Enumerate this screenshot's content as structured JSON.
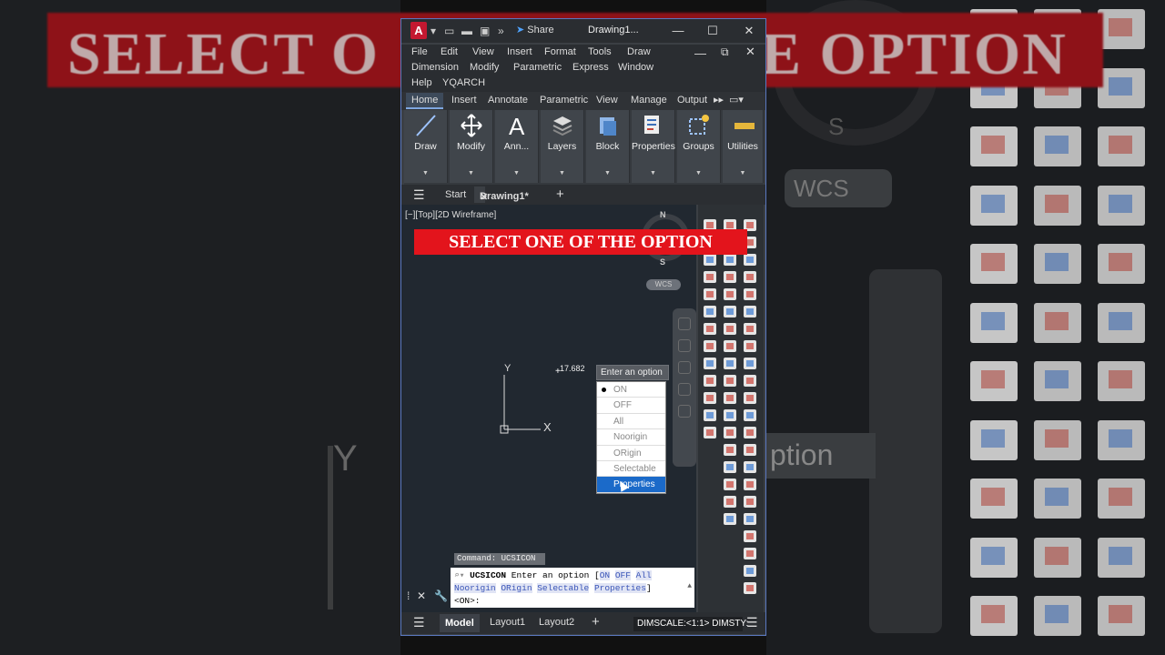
{
  "app": {
    "logo_letter": "A",
    "share_label": "Share",
    "window_title": "Drawing1..."
  },
  "menu": [
    "File",
    "Edit",
    "View",
    "Insert",
    "Format",
    "Tools",
    "Draw",
    "Dimension",
    "Modify",
    "Parametric",
    "Express",
    "Window",
    "Help",
    "YQARCH"
  ],
  "ribbon_tabs": [
    "Home",
    "Insert",
    "Annotate",
    "Parametric",
    "View",
    "Manage",
    "Output"
  ],
  "ribbon_panels": [
    "Draw",
    "Modify",
    "Ann...",
    "Layers",
    "Block",
    "Properties",
    "Groups",
    "Utilities"
  ],
  "file_tabs": {
    "start": "Start",
    "active": "Drawing1*",
    "close": "✕",
    "add": "+"
  },
  "viewport_label": "[−][Top][2D Wireframe]",
  "overlay_banner": "SELECT ONE OF THE OPTION",
  "compass": {
    "north": "N",
    "south": "S",
    "wcs": "WCS"
  },
  "ucs_icon": {
    "y_label": "Y",
    "x_label": "X"
  },
  "coordinate_readout": "17.682",
  "prompt_tooltip": "Enter an option",
  "options": [
    "ON",
    "OFF",
    "All",
    "Noorigin",
    "ORigin",
    "Selectable",
    "Properties"
  ],
  "options_current": "ON",
  "options_highlighted": "Properties",
  "command_history": "Command: UCSICON",
  "command_line": {
    "command": "UCSICON",
    "prompt_text": "Enter an option [",
    "keywords": [
      "ON",
      "OFF",
      "All",
      "Noorigin",
      "ORigin",
      "Selectable",
      "Properties"
    ],
    "prompt_end": "]",
    "default": "<ON>:"
  },
  "status": {
    "model_tab": "Model",
    "layout1": "Layout1",
    "layout2": "Layout2",
    "add": "+",
    "dimscale": "DIMSCALE:<1:1> DIMSTY:"
  },
  "background_banner_left": "SELECT O",
  "background_banner_right": "E OPTION",
  "background_option_text": "ption",
  "background_wcs": "WCS",
  "background_s": "S",
  "background_y": "Y",
  "colors": {
    "accent": "#1b6ac9",
    "banner": "#e3141c",
    "logo": "#c41830",
    "canvas": "#212830"
  }
}
